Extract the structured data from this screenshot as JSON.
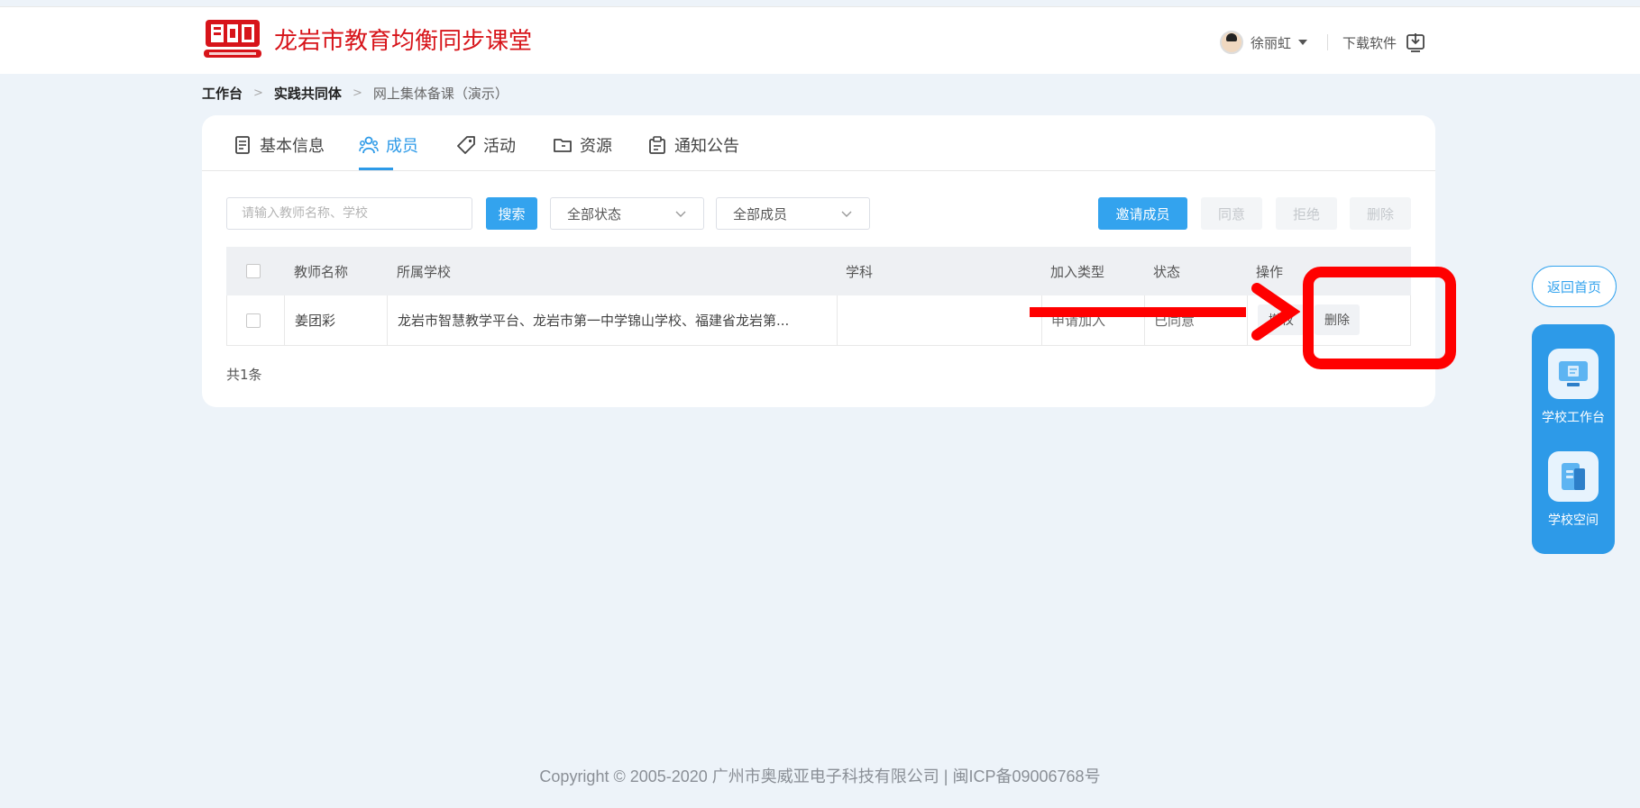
{
  "header": {
    "logo_text": "龙岩市教育均衡同步课堂",
    "user_name": "徐丽虹",
    "download_label": "下载软件"
  },
  "breadcrumb": [
    "工作台",
    "实践共同体",
    "网上集体备课（演示）"
  ],
  "tabs": [
    {
      "label": "基本信息",
      "icon": "document-icon"
    },
    {
      "label": "成员",
      "icon": "members-icon",
      "active": true
    },
    {
      "label": "活动",
      "icon": "tag-icon"
    },
    {
      "label": "资源",
      "icon": "folder-icon"
    },
    {
      "label": "通知公告",
      "icon": "clipboard-icon"
    }
  ],
  "toolbar": {
    "search_placeholder": "请输入教师名称、学校",
    "search_button": "搜索",
    "status_select": "全部状态",
    "member_select": "全部成员",
    "invite_button": "邀请成员",
    "agree_button": "同意",
    "reject_button": "拒绝",
    "delete_button": "删除"
  },
  "table": {
    "columns": [
      "教师名称",
      "所属学校",
      "学科",
      "加入类型",
      "状态",
      "操作"
    ],
    "rows": [
      {
        "name": "姜团彩",
        "school": "龙岩市智慧教学平台、龙岩市第一中学锦山学校、福建省龙岩第...",
        "subject": "",
        "join_type": "申请加入",
        "status": "已同意",
        "op_first": "撤权",
        "op_delete": "删除"
      }
    ]
  },
  "total_text": "共1条",
  "side": {
    "back_home": "返回首页",
    "school_workbench": "学校工作台",
    "school_space": "学校空间"
  },
  "footer": "Copyright © 2005-2020 广州市奥威亚电子科技有限公司 | 闽ICP备09006768号",
  "colors": {
    "primary": "#33a3ee",
    "logo_red": "#d7141a",
    "annotation_red": "#ff0000",
    "background": "#edf3f9"
  }
}
